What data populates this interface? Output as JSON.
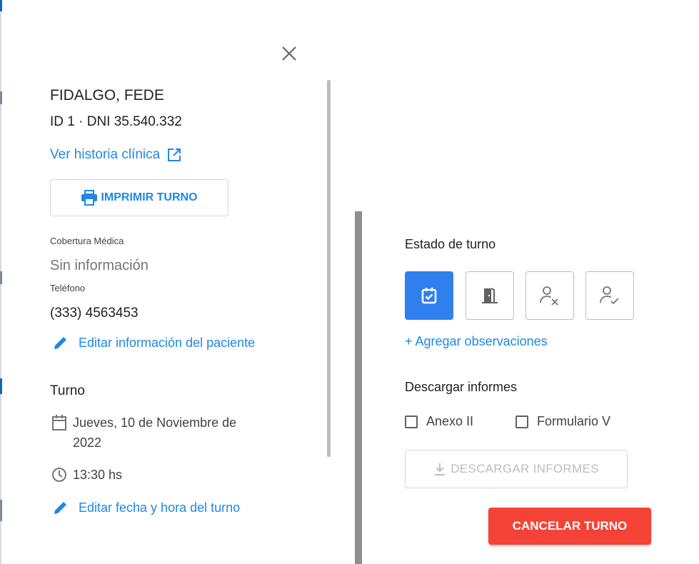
{
  "patient": {
    "name": "FIDALGO, FEDE",
    "ids": "ID 1 · DNI 35.540.332",
    "history_link": "Ver historia clínica",
    "print_label": "IMPRIMIR TURNO",
    "coverage_label": "Cobertura Médica",
    "coverage_value": "Sin información",
    "phone_label": "Teléfono",
    "phone_value": "(333) 4563453",
    "edit_patient_link": "Editar información del paciente"
  },
  "turno": {
    "section_title": "Turno",
    "date": "Jueves, 10 de Noviembre de 2022",
    "time": "13:30 hs",
    "edit_link": "Editar fecha y hora del turno"
  },
  "estado": {
    "title": "Estado de turno",
    "states": [
      {
        "icon": "calendar-check-icon",
        "active": true
      },
      {
        "icon": "door-icon",
        "active": false
      },
      {
        "icon": "person-x-icon",
        "active": false
      },
      {
        "icon": "person-check-icon",
        "active": false
      }
    ],
    "add_observations": "+ Agregar observaciones"
  },
  "informes": {
    "title": "Descargar informes",
    "options": [
      "Anexo II",
      "Formulario V"
    ],
    "download_label": "DESCARGAR INFORMES"
  },
  "actions": {
    "cancel_label": "CANCELAR TURNO"
  },
  "colors": {
    "link": "#1e88e5",
    "active_state": "#2f80ed",
    "cancel": "#f44336"
  }
}
